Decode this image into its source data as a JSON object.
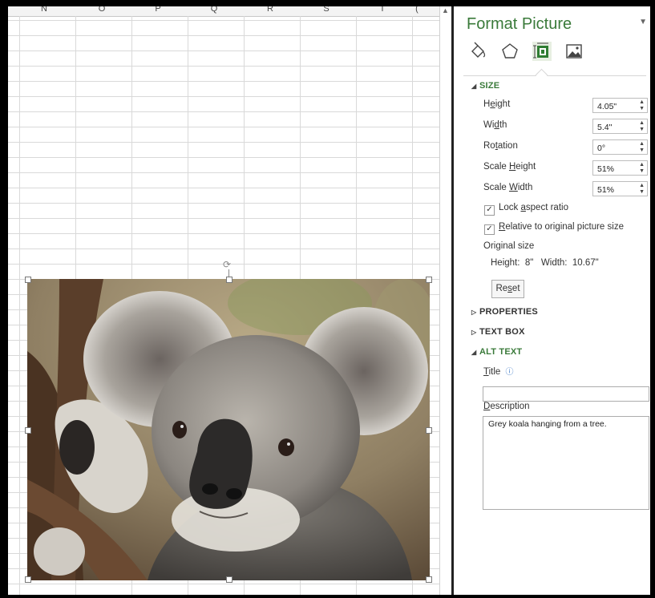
{
  "columns": [
    "N",
    "O",
    "P",
    "Q",
    "R",
    "S",
    "T",
    "("
  ],
  "picture": {
    "alt": "Grey koala hanging from a tree."
  },
  "panel": {
    "title": "Format Picture",
    "tabs": [
      {
        "icon": "fill-line-icon"
      },
      {
        "icon": "effects-icon"
      },
      {
        "icon": "size-properties-icon"
      },
      {
        "icon": "picture-icon"
      }
    ],
    "size": {
      "header": "SIZE",
      "height_label_pre": "H",
      "height_label_u": "e",
      "height_label_post": "ight",
      "height": "4.05\"",
      "width_label_pre": "Wi",
      "width_label_u": "d",
      "width_label_post": "th",
      "width": "5.4\"",
      "rotation_label_pre": "Ro",
      "rotation_label_u": "t",
      "rotation_label_post": "ation",
      "rotation": "0°",
      "scale_height_label_pre": "Scale ",
      "scale_height_label_u": "H",
      "scale_height_label_post": "eight",
      "scale_height": "51%",
      "scale_width_label_pre": "Scale ",
      "scale_width_label_u": "W",
      "scale_width_label_post": "idth",
      "scale_width": "51%",
      "lock_pre": "Lock ",
      "lock_u": "a",
      "lock_post": "spect ratio",
      "lock_checked": true,
      "relative_pre": "",
      "relative_u": "R",
      "relative_post": "elative to original picture size",
      "relative_checked": true,
      "original_size_label": "Original size",
      "original_height_label": "Height:",
      "original_height": "8\"",
      "original_width_label": "Width:",
      "original_width": "10.67\"",
      "reset_pre": "Re",
      "reset_u": "s",
      "reset_post": "et"
    },
    "properties_header": "PROPERTIES",
    "textbox_header": "TEXT BOX",
    "alt_text": {
      "header": "ALT TEXT",
      "title_label_u": "T",
      "title_label_post": "itle",
      "title_value": "",
      "description_label_u": "D",
      "description_label_post": "escription",
      "description_value": "Grey koala hanging from a tree."
    }
  }
}
